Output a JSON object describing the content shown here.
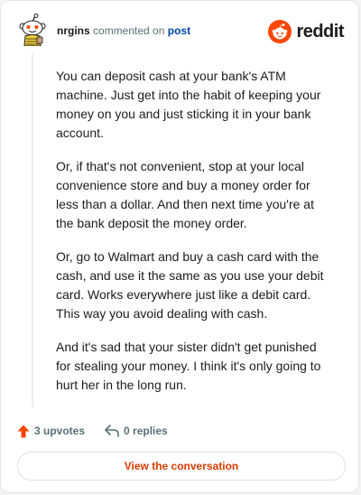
{
  "header": {
    "username": "nrgins",
    "action_text": "commented on",
    "post_link": "post",
    "brand": "reddit"
  },
  "comment": {
    "paragraphs": [
      "You can deposit cash at your bank's ATM machine. Just get into the habit of keeping your money on you and just sticking it in your bank account.",
      "Or, if that's not convenient, stop at your local convenience store and buy a money order for less than a dollar. And then next time you're at the bank deposit the money order.",
      "Or, go to Walmart and buy a cash card with the cash, and use it the same as you use your debit card. Works everywhere just like a debit card. This way you avoid dealing with cash.",
      "And it's sad that your sister didn't get punished for stealing your money. I think it's only going to hurt her in the long run."
    ]
  },
  "actions": {
    "upvotes": "3 upvotes",
    "replies": "0 replies"
  },
  "view_button": "View the conversation",
  "colors": {
    "accent": "#ff4500",
    "link": "#0045ac",
    "button_text": "#d93a00",
    "muted": "#576f76"
  }
}
